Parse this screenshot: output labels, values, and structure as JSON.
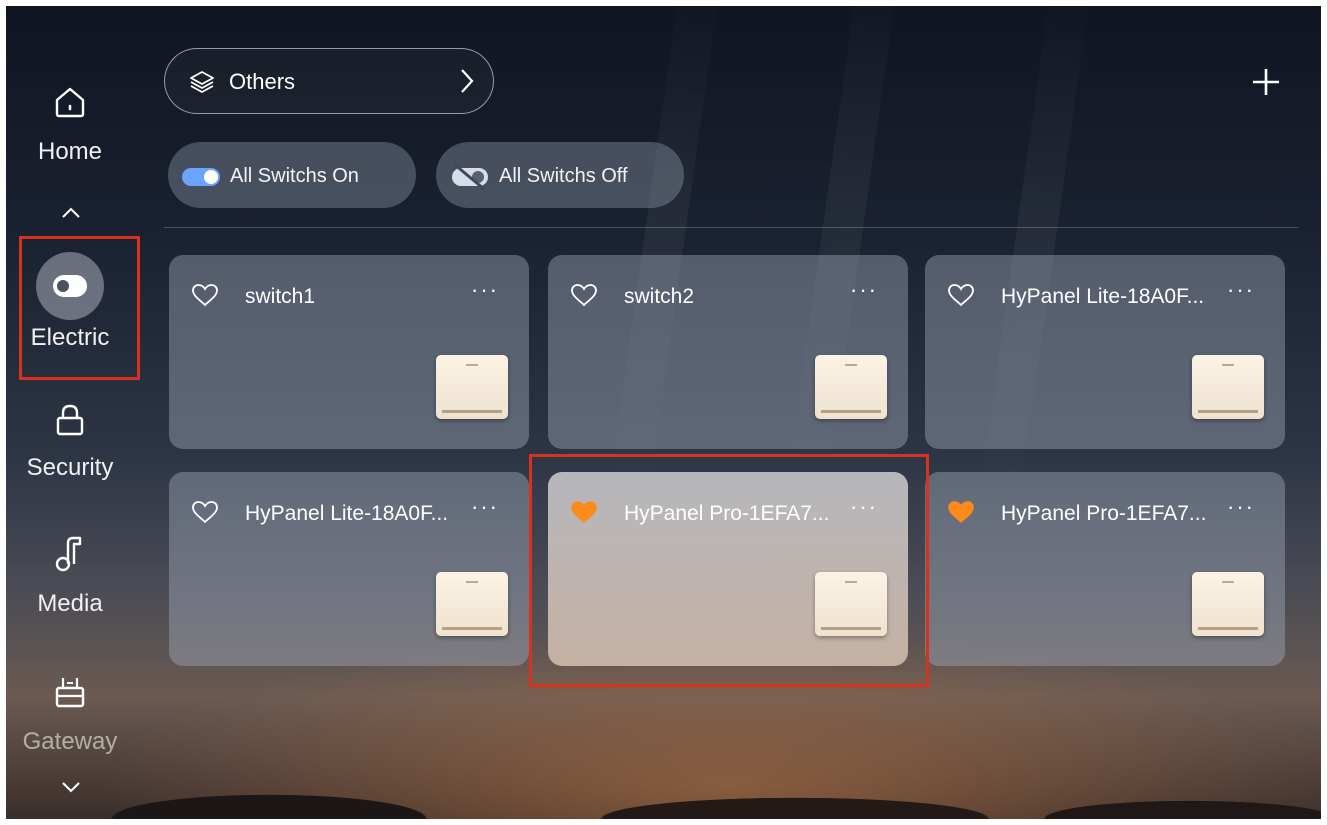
{
  "sidebar": {
    "items": [
      {
        "label": "Home",
        "icon": "home-icon"
      },
      {
        "label": "Electric",
        "icon": "toggle-icon",
        "selected": true
      },
      {
        "label": "Security",
        "icon": "lock-icon"
      },
      {
        "label": "Media",
        "icon": "music-note-icon"
      },
      {
        "label": "Gateway",
        "icon": "router-icon"
      }
    ],
    "up_icon": "chevron-up-icon",
    "down_icon": "chevron-down-icon"
  },
  "header": {
    "room_label": "Others",
    "room_icon": "layers-icon",
    "add_icon": "plus-icon"
  },
  "quick_actions": {
    "all_on_label": "All Switchs On",
    "all_off_label": "All Switchs Off"
  },
  "cards": [
    {
      "name": "switch1",
      "favorite": false
    },
    {
      "name": "switch2",
      "favorite": false
    },
    {
      "name": "HyPanel Lite-18A0F...",
      "favorite": false
    },
    {
      "name": "HyPanel Lite-18A0F...",
      "favorite": false
    },
    {
      "name": "HyPanel Pro-1EFA7...",
      "favorite": true,
      "active": true
    },
    {
      "name": "HyPanel Pro-1EFA7...",
      "favorite": true
    }
  ],
  "card_more_label": "···",
  "colors": {
    "highlight": "#d8321f",
    "favorite": "#ff8a1c",
    "toggle_on": "#6aa4ff"
  }
}
